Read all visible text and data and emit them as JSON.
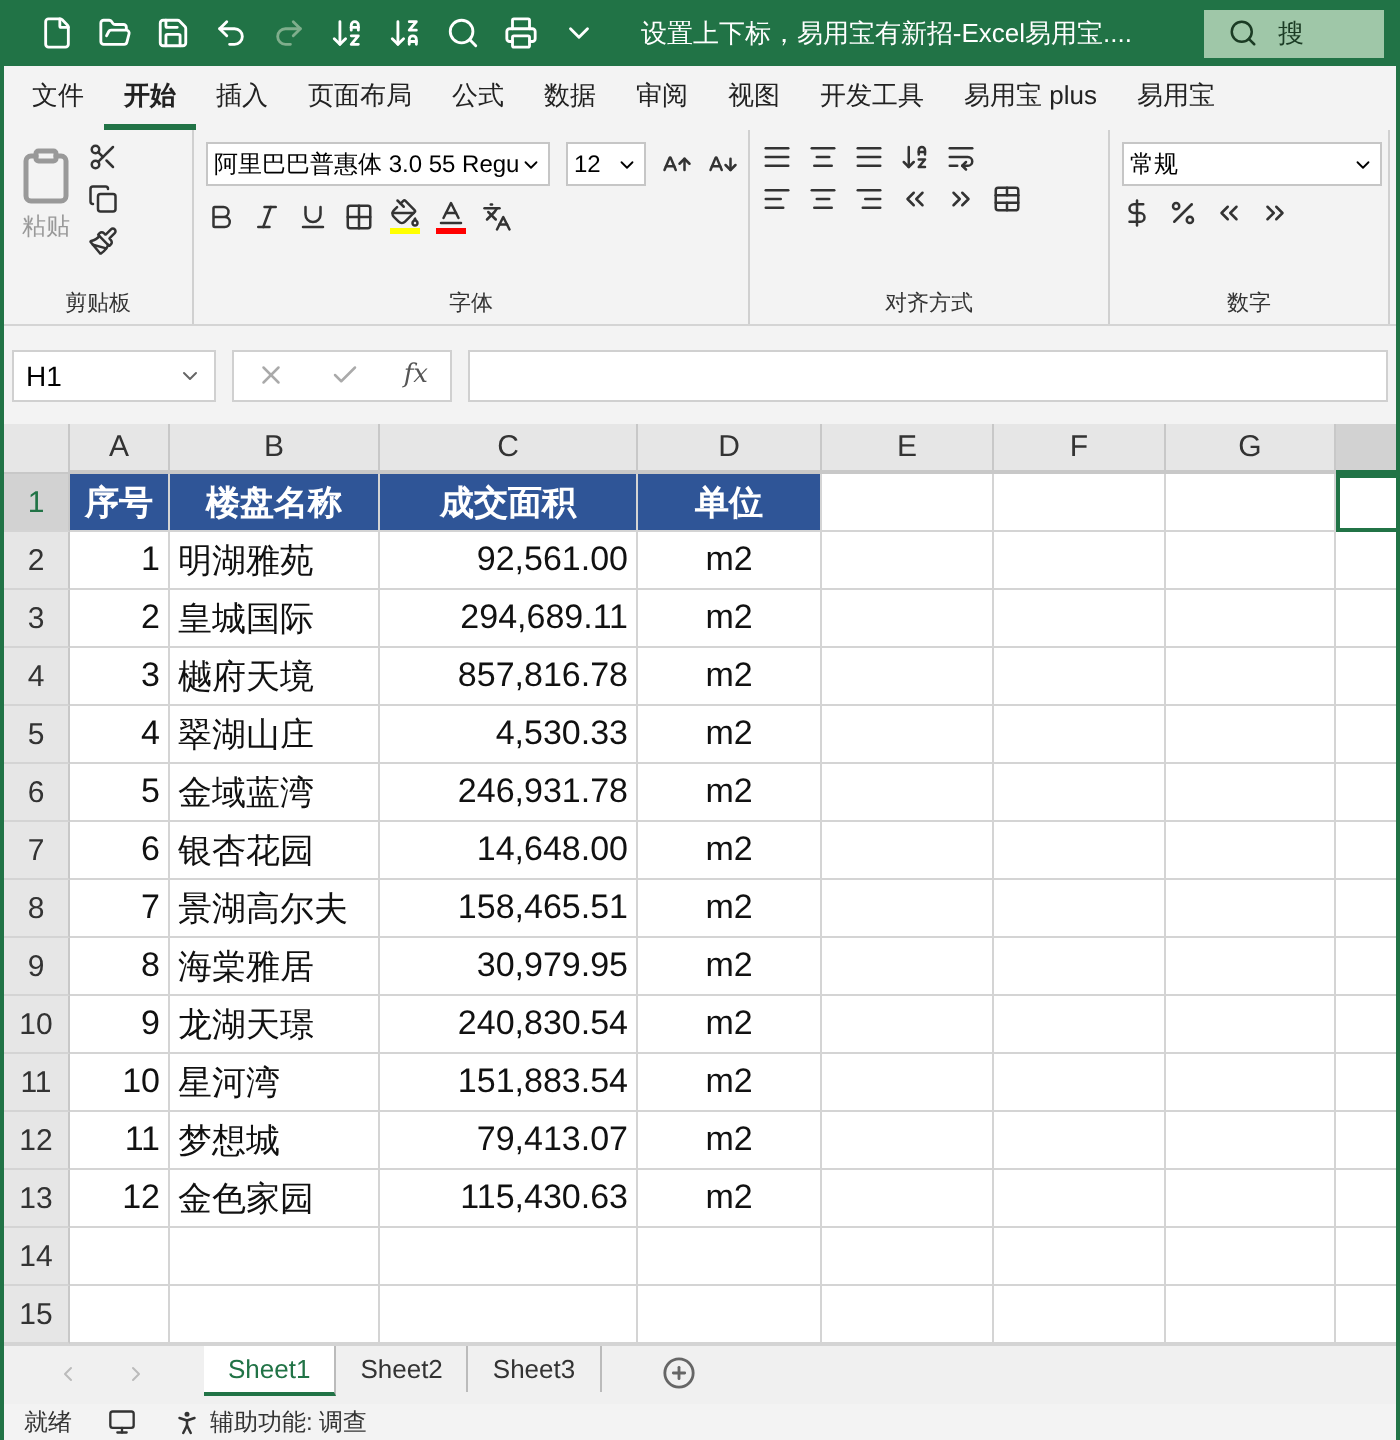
{
  "window": {
    "title": "设置上下标，易用宝有新招-Excel易用宝....",
    "search": "搜"
  },
  "menu_tabs": [
    {
      "label": "文件",
      "selected": false
    },
    {
      "label": "开始",
      "selected": true
    },
    {
      "label": "插入",
      "selected": false
    },
    {
      "label": "页面布局",
      "selected": false
    },
    {
      "label": "公式",
      "selected": false
    },
    {
      "label": "数据",
      "selected": false
    },
    {
      "label": "审阅",
      "selected": false
    },
    {
      "label": "视图",
      "selected": false
    },
    {
      "label": "开发工具",
      "selected": false
    },
    {
      "label": "易用宝 plus",
      "selected": false
    },
    {
      "label": "易用宝",
      "selected": false
    }
  ],
  "ribbon": {
    "paste_label": "粘贴",
    "font_name": "阿里巴巴普惠体 3.0 55 Regu",
    "font_size": "12",
    "number_format": "常规",
    "groups": [
      "剪贴板",
      "字体",
      "对齐方式",
      "数字"
    ]
  },
  "formula_bar": {
    "name_box": "H1",
    "function_label": "fx"
  },
  "columns": [
    {
      "label": "A",
      "selected": false
    },
    {
      "label": "B",
      "selected": false
    },
    {
      "label": "C",
      "selected": false
    },
    {
      "label": "D",
      "selected": false
    },
    {
      "label": "E",
      "selected": false
    },
    {
      "label": "F",
      "selected": false
    },
    {
      "label": "G",
      "selected": false
    },
    {
      "selected": true
    }
  ],
  "rows": [
    {
      "number": "1",
      "kind": "header",
      "selected": true,
      "cells": [
        "序号",
        "楼盘名称",
        "成交面积",
        "单位"
      ]
    },
    {
      "number": "2",
      "kind": "data",
      "selected": false,
      "cells": [
        "1",
        "明湖雅苑",
        "92,561.00",
        "m2"
      ]
    },
    {
      "number": "3",
      "kind": "data",
      "selected": false,
      "cells": [
        "2",
        "皇城国际",
        "294,689.11",
        "m2"
      ]
    },
    {
      "number": "4",
      "kind": "data",
      "selected": false,
      "cells": [
        "3",
        "樾府天境",
        "857,816.78",
        "m2"
      ]
    },
    {
      "number": "5",
      "kind": "data",
      "selected": false,
      "cells": [
        "4",
        "翠湖山庄",
        "4,530.33",
        "m2"
      ]
    },
    {
      "number": "6",
      "kind": "data",
      "selected": false,
      "cells": [
        "5",
        "金域蓝湾",
        "246,931.78",
        "m2"
      ]
    },
    {
      "number": "7",
      "kind": "data",
      "selected": false,
      "cells": [
        "6",
        "银杏花园",
        "14,648.00",
        "m2"
      ]
    },
    {
      "number": "8",
      "kind": "data",
      "selected": false,
      "cells": [
        "7",
        "景湖高尔夫",
        "158,465.51",
        "m2"
      ]
    },
    {
      "number": "9",
      "kind": "data",
      "selected": false,
      "cells": [
        "8",
        "海棠雅居",
        "30,979.95",
        "m2"
      ]
    },
    {
      "number": "10",
      "kind": "data",
      "selected": false,
      "cells": [
        "9",
        "龙湖天璟",
        "240,830.54",
        "m2"
      ]
    },
    {
      "number": "11",
      "kind": "data",
      "selected": false,
      "cells": [
        "10",
        "星河湾",
        "151,883.54",
        "m2"
      ]
    },
    {
      "number": "12",
      "kind": "data",
      "selected": false,
      "cells": [
        "11",
        "梦想城",
        "79,413.07",
        "m2"
      ]
    },
    {
      "number": "13",
      "kind": "data",
      "selected": false,
      "cells": [
        "12",
        "金色家园",
        "115,430.63",
        "m2"
      ]
    },
    {
      "number": "14",
      "kind": "empty",
      "selected": false,
      "cells": []
    },
    {
      "number": "15",
      "kind": "empty",
      "selected": false,
      "cells": []
    }
  ],
  "sheets": [
    {
      "label": "Sheet1",
      "selected": true
    },
    {
      "label": "Sheet2",
      "selected": false
    },
    {
      "label": "Sheet3",
      "selected": false
    }
  ],
  "status_bar": {
    "state": "就绪",
    "accessibility": "辅助功能: 调查"
  }
}
